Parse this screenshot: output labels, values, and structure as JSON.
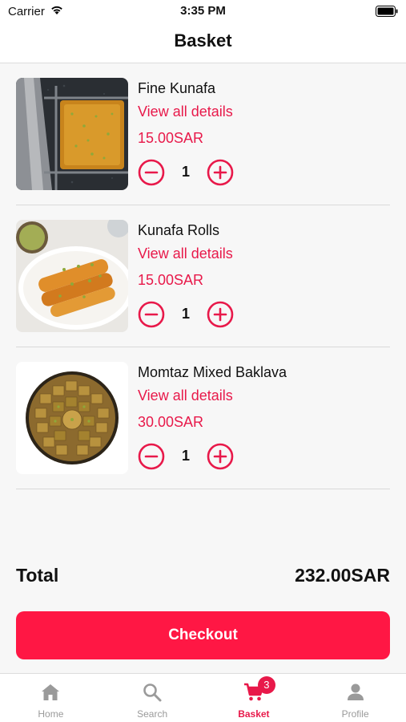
{
  "status_bar": {
    "carrier": "Carrier",
    "time": "3:35 PM",
    "wifi_icon": "wifi-icon",
    "battery_icon": "battery-icon"
  },
  "nav": {
    "title": "Basket"
  },
  "items": [
    {
      "name": "Fine Kunafa",
      "details_link": "View all details",
      "price": "15.00SAR",
      "quantity": "1"
    },
    {
      "name": "Kunafa Rolls",
      "details_link": "View all details",
      "price": "15.00SAR",
      "quantity": "1"
    },
    {
      "name": "Momtaz Mixed Baklava",
      "details_link": "View all details",
      "price": "30.00SAR",
      "quantity": "1"
    }
  ],
  "summary": {
    "total_label": "Total",
    "total_value": "232.00SAR"
  },
  "checkout": {
    "label": "Checkout"
  },
  "tabs": [
    {
      "label": "Home",
      "icon": "home-icon"
    },
    {
      "label": "Search",
      "icon": "search-icon"
    },
    {
      "label": "Basket",
      "icon": "cart-icon",
      "badge": "3",
      "active": true
    },
    {
      "label": "Profile",
      "icon": "profile-icon"
    }
  ],
  "colors": {
    "accent": "#e8194a",
    "checkout_bg": "#ff1744",
    "inactive_tab": "#9a9a9a",
    "background": "#f7f7f7"
  }
}
